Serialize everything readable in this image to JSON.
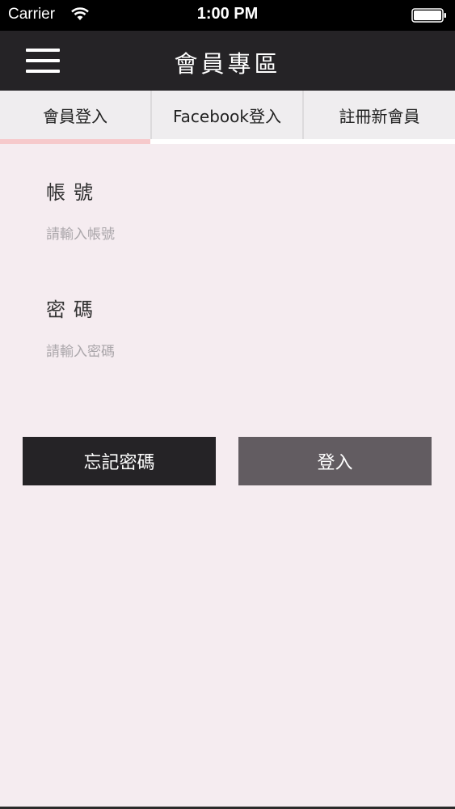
{
  "status_bar": {
    "carrier": "Carrier",
    "time": "1:00 PM"
  },
  "nav": {
    "title": "會員專區",
    "menu_icon": "hamburger-menu-icon"
  },
  "tabs": [
    {
      "label": "會員登入",
      "active": true
    },
    {
      "label": "Facebook登入",
      "active": false
    },
    {
      "label": "註冊新會員",
      "active": false
    }
  ],
  "form": {
    "account": {
      "label": "帳號",
      "placeholder": "請輸入帳號",
      "value": ""
    },
    "password": {
      "label": "密碼",
      "placeholder": "請輸入密碼",
      "value": ""
    }
  },
  "buttons": {
    "forgot_label": "忘記密碼",
    "login_label": "登入"
  },
  "colors": {
    "background": "#f5ecf0",
    "nav_bar": "#252326",
    "tab_bg": "#efedef",
    "tab_indicator": "#f6c9cb",
    "forgot_button": "#252326",
    "login_button": "#625c61",
    "placeholder": "#aaa6aa"
  }
}
